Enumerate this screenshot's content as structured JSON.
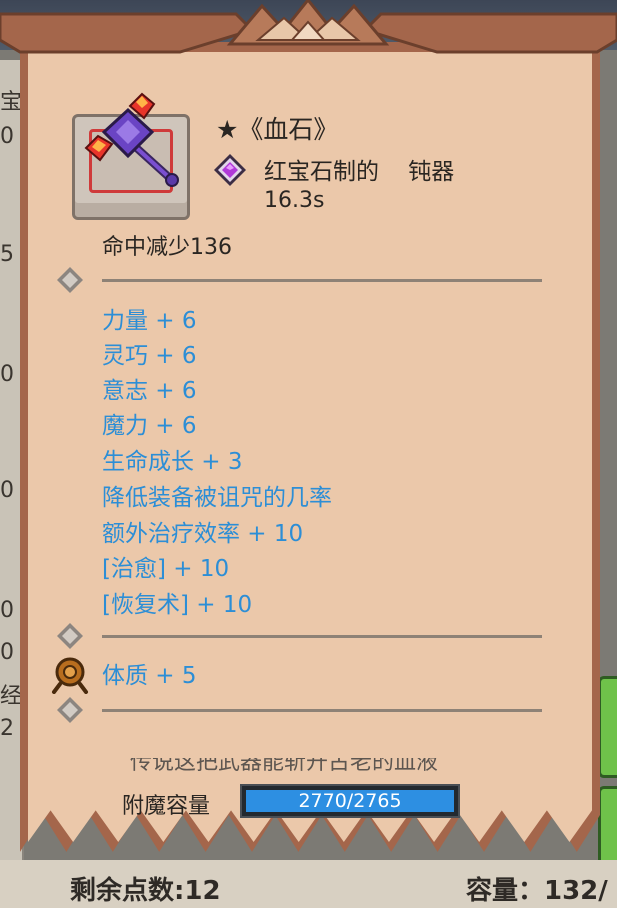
{
  "background": {
    "edge_glyphs": [
      "宝",
      "0",
      "5",
      "0",
      "0",
      "0",
      "0",
      "经",
      "2"
    ],
    "bottom_left": "剩余点数:12",
    "bottom_right": "容量：132/"
  },
  "item": {
    "title": "★《血石》",
    "type": "红宝石制的    钝器",
    "speed": "16.3s",
    "hit_penalty": "命中减少136",
    "icon": "ruby-mace-icon",
    "gem_icon": "purple-gem-icon"
  },
  "stats": [
    "力量 + 6",
    "灵巧 + 6",
    "意志 + 6",
    "魔力 + 6",
    "生命成长 + 3",
    "降低装备被诅咒的几率",
    "额外治疗效率 + 10",
    "[治愈] + 10",
    "[恢复术] + 10"
  ],
  "socket": {
    "icon": "bronze-seal-icon",
    "stat": "体质 + 5"
  },
  "hidden_text": "传说这把武器能斩开古老的血液",
  "enchant": {
    "label": "附魔容量",
    "value": "2770/2765",
    "fill_fraction": 1.0
  },
  "colors": {
    "stat_blue": "#2c8ed6",
    "parchment": "#ebc8aa",
    "frame": "#a4664b",
    "bar_fill": "#2d8fe2"
  }
}
